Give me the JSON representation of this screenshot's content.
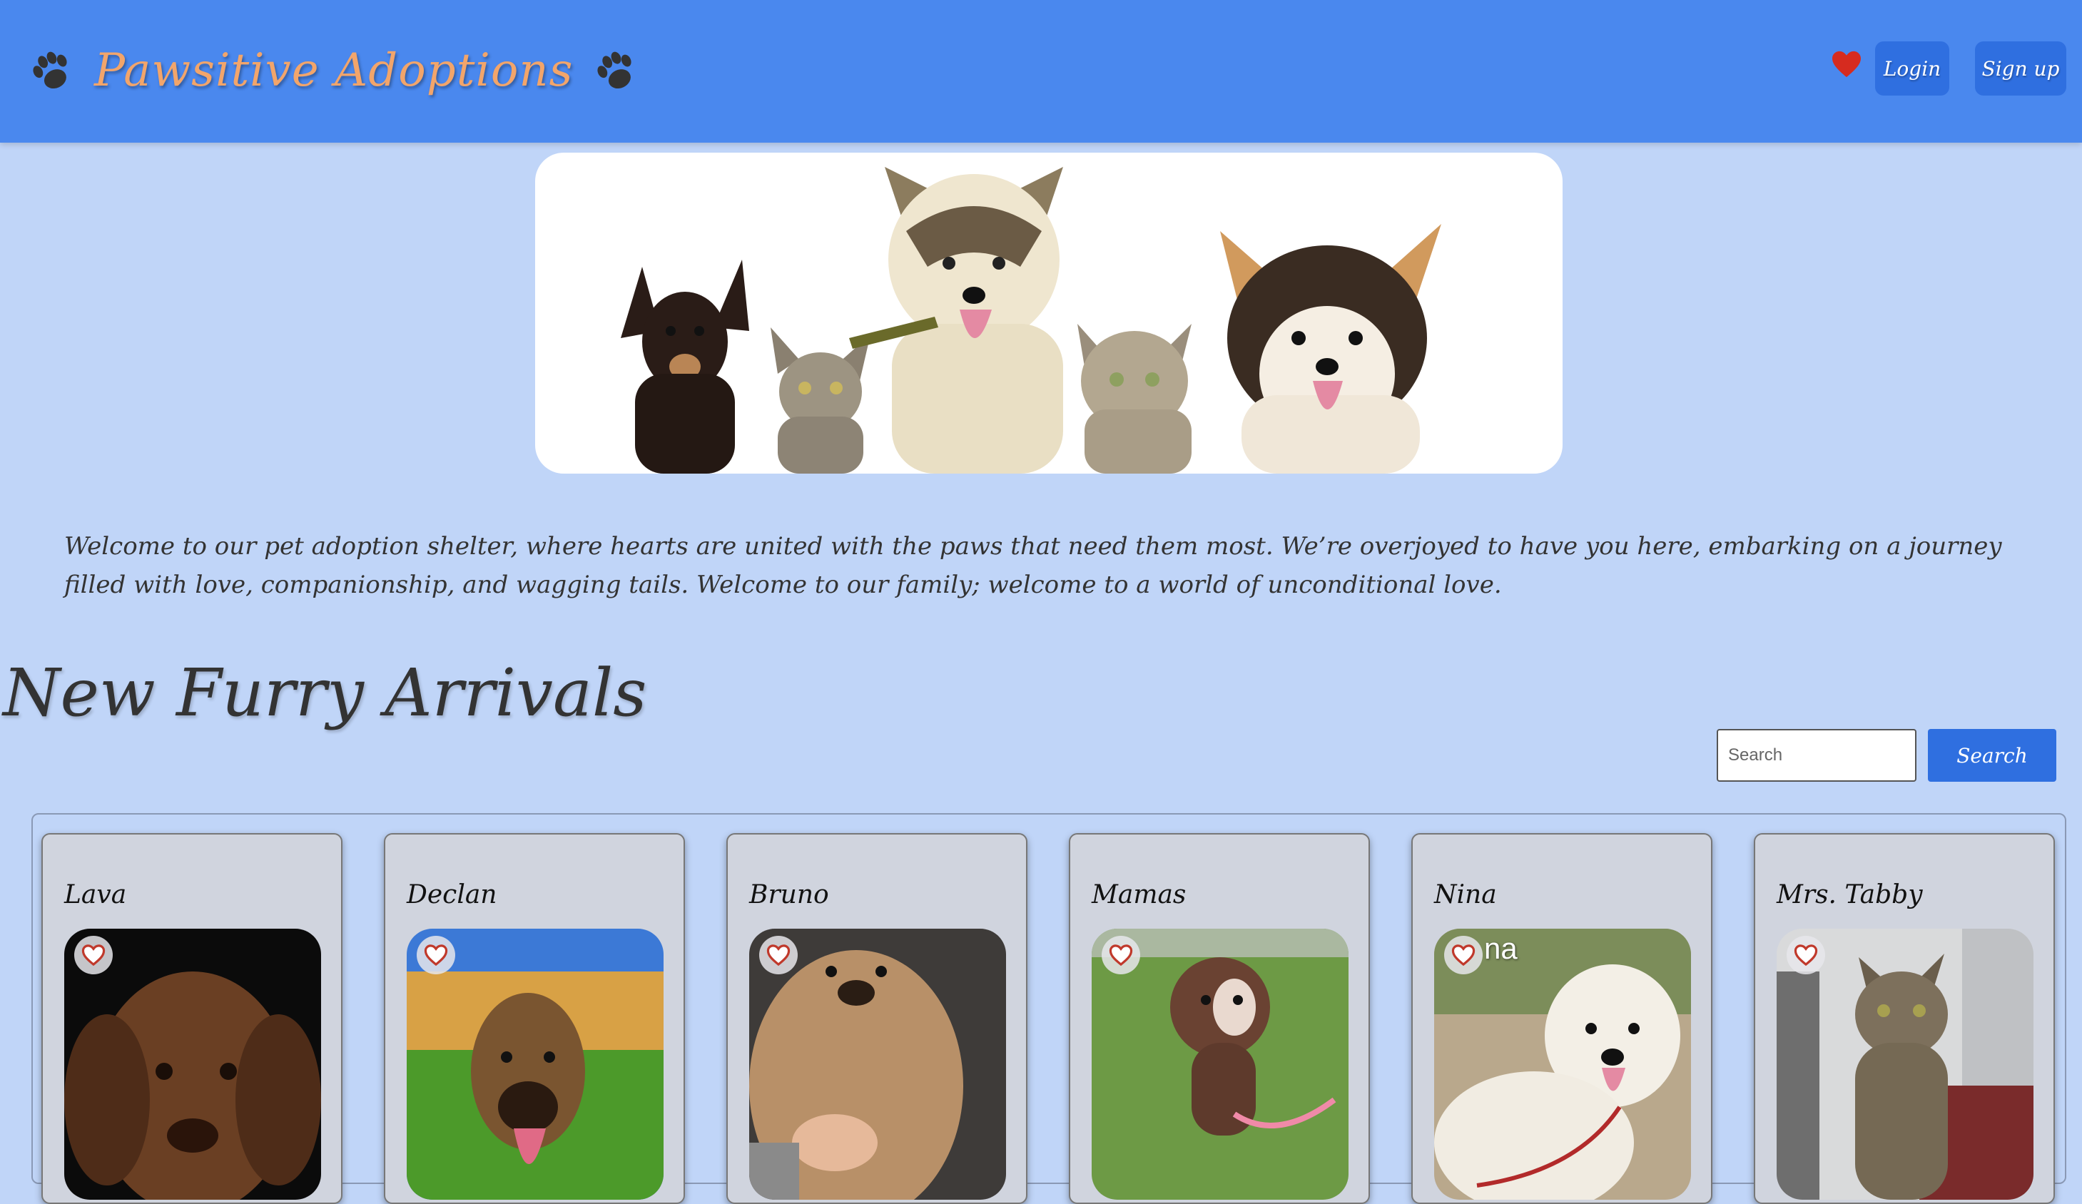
{
  "header": {
    "title": "Pawsitive Adoptions",
    "login_label": "Login",
    "signup_label": "Sign up"
  },
  "welcome_text": "Welcome to our pet adoption shelter, where hearts are united with the paws that need them most. We’re overjoyed to have you here, embarking on a journey filled with love, companionship, and wagging tails. Welcome to our family; welcome to a world of unconditional love.",
  "arrivals": {
    "title": "New Furry Arrivals",
    "search_placeholder": "Search",
    "search_button": "Search",
    "pets": [
      {
        "name": "Lava"
      },
      {
        "name": "Declan"
      },
      {
        "name": "Bruno"
      },
      {
        "name": "Mamas"
      },
      {
        "name": "Nina",
        "photo_caption": "na"
      },
      {
        "name": "Mrs. Tabby"
      }
    ]
  },
  "colors": {
    "header": "#4a88ee",
    "page_bg": "#c0d5f8",
    "button": "#2f6fe0",
    "brand": "#f2a56b",
    "heart": "#d62b1f"
  }
}
